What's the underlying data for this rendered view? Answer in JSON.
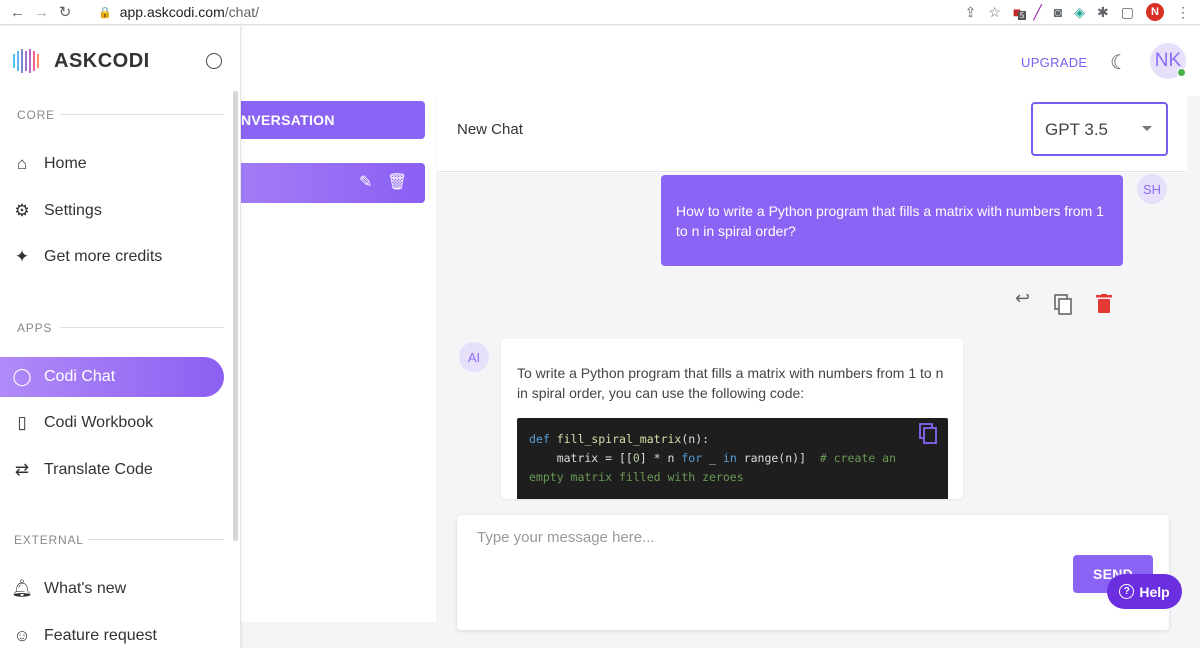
{
  "browser": {
    "url_host": "app.askcodi.com",
    "url_path": "/chat/",
    "profile_initial": "N",
    "ext_badge": "5"
  },
  "brand": {
    "name": "ASKCODI"
  },
  "sidebar": {
    "sections": [
      {
        "label": "CORE"
      },
      {
        "label": "APPS"
      },
      {
        "label": "EXTERNAL"
      }
    ],
    "items": [
      {
        "label": "Home",
        "icon": "home-icon"
      },
      {
        "label": "Settings",
        "icon": "gear-icon"
      },
      {
        "label": "Get more credits",
        "icon": "sparkle-icon"
      },
      {
        "label": "Codi Chat",
        "icon": "chat-bubble-icon",
        "active": true
      },
      {
        "label": "Codi Workbook",
        "icon": "notebook-icon"
      },
      {
        "label": "Translate Code",
        "icon": "swap-arrows-icon"
      },
      {
        "label": "What's new",
        "icon": "bell-icon"
      },
      {
        "label": "Feature request",
        "icon": "smiley-icon"
      }
    ]
  },
  "header": {
    "upgrade_label": "UPGRADE",
    "avatar_initials": "NK"
  },
  "conversations": {
    "new_button_label": "NVERSATION"
  },
  "chat": {
    "title": "New Chat",
    "model": "GPT 3.5",
    "user_initials": "SH",
    "ai_initials": "AI",
    "user_message": "How to write a Python program that fills a matrix with numbers from 1 to n in spiral order?",
    "ai_message": "To write a Python program that fills a matrix with numbers from 1 to n in spiral order, you can use the following code:",
    "code": {
      "line1_kw": "def",
      "line1_fn": "fill_spiral_matrix",
      "line1_rest": "(n):",
      "line2_a": "    matrix = [[",
      "line2_num": "0",
      "line2_b": "] * n ",
      "line2_kw1": "for",
      "line2_c": " _ ",
      "line2_kw2": "in",
      "line2_d": " range(n)]  ",
      "line2_cmt": "# create an",
      "line3_cmt": "empty matrix filled with zeroes"
    }
  },
  "composer": {
    "placeholder": "Type your message here...",
    "send_label": "SEND"
  },
  "help": {
    "label": "Help"
  },
  "colors": {
    "accent": "#8b63f5",
    "help": "#6b2fe0",
    "delete": "#e53935"
  }
}
